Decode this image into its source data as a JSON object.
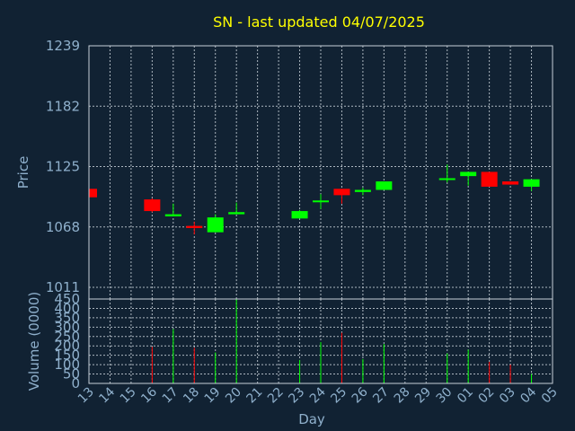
{
  "chart_data": {
    "type": "candlestick",
    "title": "SN - last updated 04/07/2025",
    "xlabel": "Day",
    "price": {
      "ylabel": "Price",
      "ylim": [
        1000,
        1239
      ],
      "yticks": [
        1239,
        1182,
        1125,
        1068,
        1011
      ]
    },
    "volume": {
      "ylabel": "Volume (0000)",
      "ylim": [
        0,
        450
      ],
      "yticks": [
        450,
        400,
        350,
        300,
        250,
        200,
        150,
        100,
        50,
        0
      ]
    },
    "x_labels": [
      "13",
      "14",
      "15",
      "16",
      "17",
      "18",
      "19",
      "20",
      "21",
      "22",
      "23",
      "24",
      "25",
      "26",
      "27",
      "28",
      "29",
      "30",
      "01",
      "02",
      "03",
      "04",
      "05"
    ],
    "candles": [
      {
        "idx": 0,
        "open": 1104,
        "close": 1096,
        "high": 1104,
        "low": 1096,
        "volume": 0
      },
      {
        "idx": 3,
        "open": 1094,
        "close": 1083,
        "high": 1095,
        "low": 1082,
        "volume": 195
      },
      {
        "idx": 4,
        "open": 1078,
        "close": 1080,
        "high": 1090,
        "low": 1079,
        "volume": 290
      },
      {
        "idx": 5,
        "open": 1069,
        "close": 1067,
        "high": 1073,
        "low": 1061,
        "volume": 190
      },
      {
        "idx": 6,
        "open": 1063,
        "close": 1077,
        "high": 1080,
        "low": 1063,
        "volume": 165
      },
      {
        "idx": 7,
        "open": 1080,
        "close": 1082,
        "high": 1091,
        "low": 1080,
        "volume": 450
      },
      {
        "idx": 10,
        "open": 1076,
        "close": 1083,
        "high": 1084,
        "low": 1076,
        "volume": 125
      },
      {
        "idx": 11,
        "open": 1092,
        "close": 1093,
        "high": 1099,
        "low": 1085,
        "volume": 220
      },
      {
        "idx": 12,
        "open": 1104,
        "close": 1098,
        "high": 1104,
        "low": 1090,
        "volume": 270
      },
      {
        "idx": 13,
        "open": 1101,
        "close": 1103,
        "high": 1105,
        "low": 1098,
        "volume": 130
      },
      {
        "idx": 14,
        "open": 1103,
        "close": 1111,
        "high": 1111,
        "low": 1103,
        "volume": 210
      },
      {
        "idx": 17,
        "open": 1113,
        "close": 1114,
        "high": 1127,
        "low": 1110,
        "volume": 160
      },
      {
        "idx": 18,
        "open": 1116,
        "close": 1120,
        "high": 1120,
        "low": 1107,
        "volume": 180
      },
      {
        "idx": 19,
        "open": 1120,
        "close": 1106,
        "high": 1120,
        "low": 1106,
        "volume": 115
      },
      {
        "idx": 20,
        "open": 1111,
        "close": 1108,
        "high": 1111,
        "low": 1108,
        "volume": 100
      },
      {
        "idx": 21,
        "open": 1106,
        "close": 1113,
        "high": 1113,
        "low": 1102,
        "volume": 50
      }
    ],
    "colors": {
      "background": "#112233",
      "up": "#00ff00",
      "down": "#ff0000",
      "title": "#ffff00",
      "text": "#8fb0cc",
      "grid": "#c8d0d8"
    }
  }
}
